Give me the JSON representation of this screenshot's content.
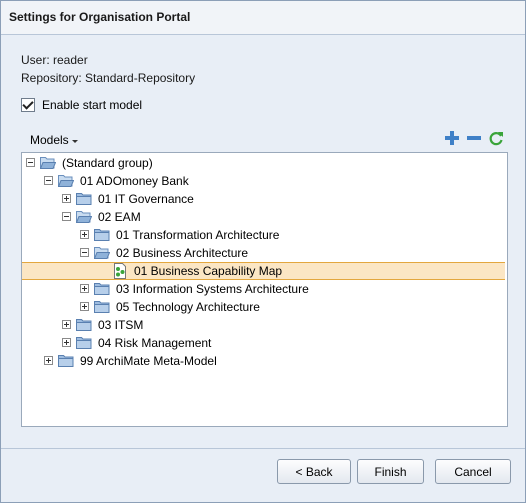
{
  "window": {
    "title": "Settings for Organisation Portal"
  },
  "info": {
    "user": "User: reader",
    "repository": "Repository: Standard-Repository"
  },
  "start_model": {
    "label": "Enable start model",
    "checked": true
  },
  "models_menu": {
    "label": "Models"
  },
  "toolbar": {
    "add_icon": "plus-icon",
    "remove_icon": "minus-icon",
    "refresh_icon": "refresh-icon"
  },
  "tree": {
    "items": [
      {
        "label": "(Standard group)",
        "depth": 0,
        "expander": "minus",
        "type": "folder"
      },
      {
        "label": "01 ADOmoney Bank",
        "depth": 1,
        "expander": "minus",
        "type": "folder"
      },
      {
        "label": "01 IT Governance",
        "depth": 2,
        "expander": "plus",
        "type": "folder"
      },
      {
        "label": "02 EAM",
        "depth": 2,
        "expander": "minus",
        "type": "folder"
      },
      {
        "label": "01 Transformation Architecture",
        "depth": 3,
        "expander": "plus",
        "type": "folder"
      },
      {
        "label": "02 Business Architecture",
        "depth": 3,
        "expander": "minus",
        "type": "folder"
      },
      {
        "label": "01 Business Capability Map",
        "depth": 4,
        "expander": "none",
        "type": "model",
        "selected": true
      },
      {
        "label": "03 Information Systems Architecture",
        "depth": 3,
        "expander": "plus",
        "type": "folder"
      },
      {
        "label": "05 Technology Architecture",
        "depth": 3,
        "expander": "plus",
        "type": "folder"
      },
      {
        "label": "03 ITSM",
        "depth": 2,
        "expander": "plus",
        "type": "folder"
      },
      {
        "label": "04 Risk Management",
        "depth": 2,
        "expander": "plus",
        "type": "folder"
      },
      {
        "label": "99 ArchiMate Meta-Model",
        "depth": 1,
        "expander": "plus",
        "type": "folder"
      }
    ]
  },
  "buttons": {
    "back": "< Back",
    "finish": "Finish",
    "cancel": "Cancel"
  },
  "colors": {
    "selection_bg": "#fbe6c4",
    "selection_border": "#e3a73e",
    "folder": "#8fb2d9",
    "model_icon": "#3aa43a"
  }
}
